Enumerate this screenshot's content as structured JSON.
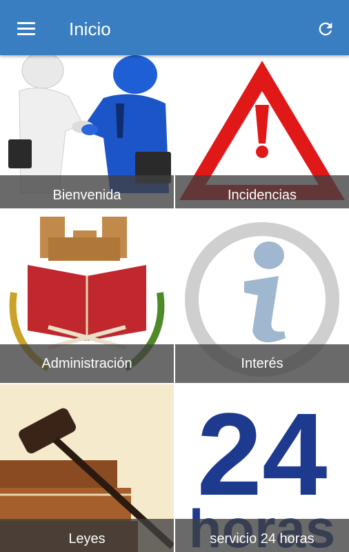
{
  "app_bar": {
    "title": "Inicio",
    "menu_icon": "hamburger-menu-icon",
    "refresh_icon": "refresh-icon",
    "background_color": "#3a7ec2"
  },
  "tiles": [
    {
      "label": "Bienvenida",
      "image": "handshake-figures-image"
    },
    {
      "label": "Incidencias",
      "image": "warning-triangle-image"
    },
    {
      "label": "Administración",
      "image": "coat-of-arms-image"
    },
    {
      "label": "Interés",
      "image": "information-symbol-image"
    },
    {
      "label": "Leyes",
      "image": "gavel-on-books-image"
    },
    {
      "label": "servicio 24 horas",
      "image": "24-horas-logo-image",
      "logo_number": "24",
      "logo_word": "horas"
    }
  ]
}
